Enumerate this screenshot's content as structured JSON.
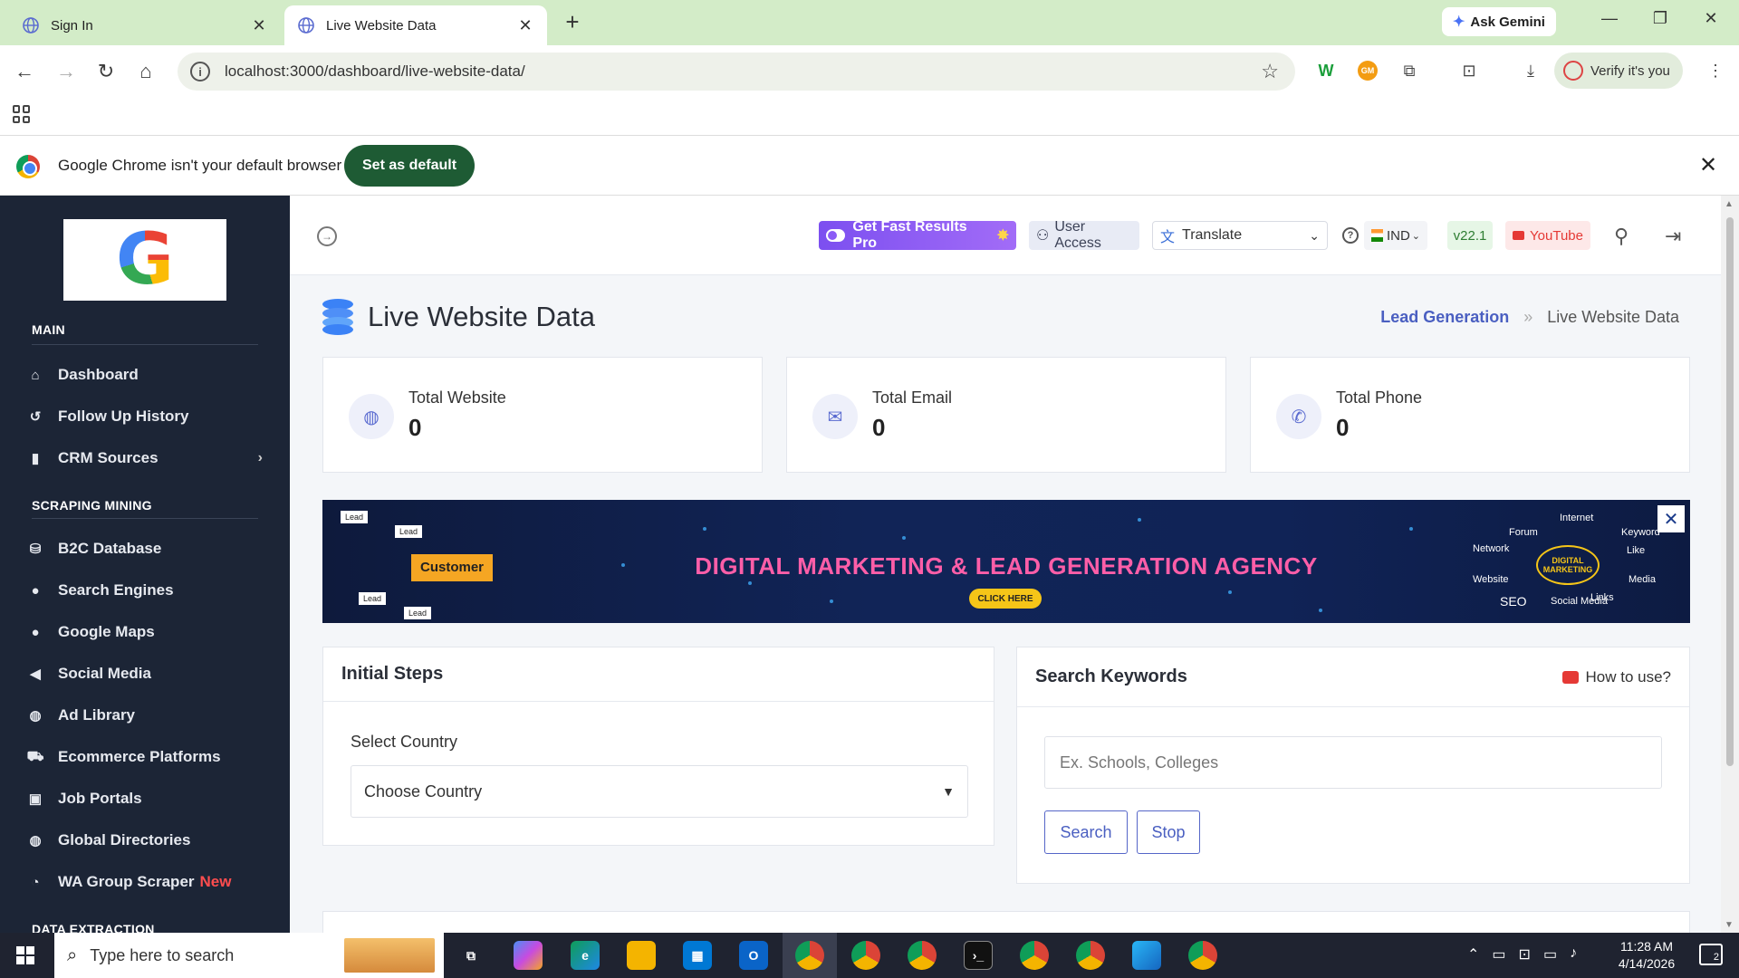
{
  "browser": {
    "tabs": [
      {
        "title": "Sign In",
        "active": false
      },
      {
        "title": "Live Website Data",
        "active": true
      }
    ],
    "ask_gemini": "Ask Gemini",
    "url": "localhost:3000/dashboard/live-website-data/",
    "verify_label": "Verify it's you",
    "infobar_text": "Google Chrome isn't your default browser",
    "set_default_label": "Set as default"
  },
  "sidebar": {
    "logo_letter": "G",
    "sections": [
      {
        "label": "MAIN"
      },
      {
        "label": "SCRAPING MINING"
      },
      {
        "label": "DATA EXTRACTION"
      }
    ],
    "items": [
      {
        "label": "Dashboard",
        "icon": "home-icon"
      },
      {
        "label": "Follow Up History",
        "icon": "history-icon"
      },
      {
        "label": "CRM Sources",
        "icon": "bar-chart-icon"
      },
      {
        "label": "B2C Database",
        "icon": "database-icon"
      },
      {
        "label": "Search Engines",
        "icon": "search-icon"
      },
      {
        "label": "Google Maps",
        "icon": "map-icon"
      },
      {
        "label": "Social Media",
        "icon": "megaphone-icon"
      },
      {
        "label": "Ad Library",
        "icon": "globe-icon"
      },
      {
        "label": "Ecommerce Platforms",
        "icon": "cart-icon"
      },
      {
        "label": "Job Portals",
        "icon": "briefcase-icon"
      },
      {
        "label": "Global Directories",
        "icon": "globe-icon"
      },
      {
        "label": "WA Group Scraper",
        "icon": "whatsapp-icon",
        "badge": "New"
      }
    ]
  },
  "topbar": {
    "pro_label": "Get Fast Results Pro",
    "user_access_label": "User Access",
    "translate_label": "Translate",
    "lang_label": "IND",
    "version": "v22.1",
    "youtube_label": "YouTube"
  },
  "page": {
    "title": "Live Website Data",
    "breadcrumb": {
      "parent": "Lead Generation",
      "current": "Live Website Data"
    }
  },
  "stats": [
    {
      "label": "Total Website",
      "value": "0",
      "icon": "globe-icon"
    },
    {
      "label": "Total Email",
      "value": "0",
      "icon": "mail-icon"
    },
    {
      "label": "Total Phone",
      "value": "0",
      "icon": "phone-icon"
    }
  ],
  "banner": {
    "headline": "DIGITAL MARKETING & LEAD GENERATION AGENCY",
    "cta": "CLICK HERE",
    "left_customer": "Customer",
    "left_lead": "Lead",
    "hub": "DIGITAL MARKETING",
    "words": [
      "Internet",
      "Keyword",
      "Forum",
      "Network",
      "Like",
      "Website",
      "Media",
      "SEO",
      "Social Media",
      "Links"
    ]
  },
  "initial_steps": {
    "title": "Initial Steps",
    "country_label": "Select Country",
    "country_value": "Choose Country"
  },
  "search_keywords": {
    "title": "Search Keywords",
    "how_to_use": "How to use?",
    "placeholder": "Ex. Schools, Colleges",
    "search_label": "Search",
    "stop_label": "Stop"
  },
  "taskbar": {
    "search_placeholder": "Type here to search",
    "time": "11:28 AM",
    "date": "4/14/2026",
    "notifications": "2"
  },
  "colors": {
    "sidebar_bg": "#1c2536",
    "accent": "#4a5fc1",
    "pro_purple": "#8b5cf6",
    "banner_pink": "#ff5ea8",
    "new_badge": "#ff4d4f"
  }
}
